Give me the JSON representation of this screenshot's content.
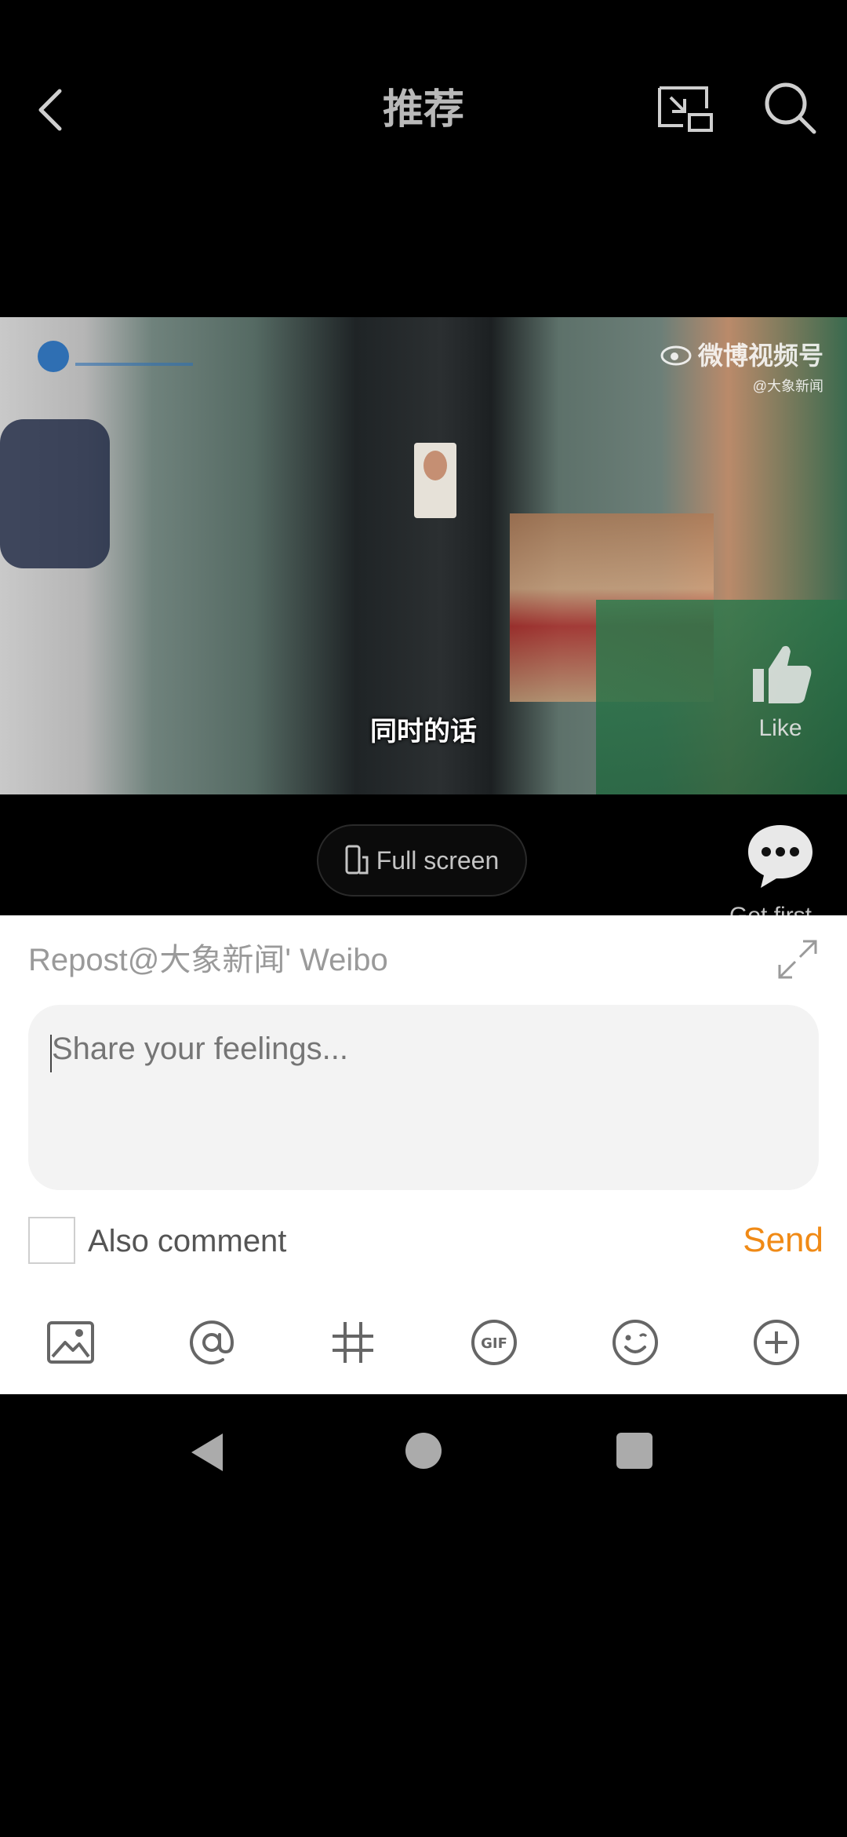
{
  "header": {
    "title": "推荐"
  },
  "video": {
    "subtitle": "同时的话",
    "watermark_brand": "微博视频号",
    "watermark_account": "@大象新闻",
    "like_label": "Like"
  },
  "controls": {
    "fullscreen_label": "Full screen",
    "comment_hint": "Get first"
  },
  "repost": {
    "title": "Repost@大象新闻' Weibo",
    "placeholder": "Share your feelings...",
    "also_comment_label": "Also comment",
    "send_label": "Send"
  },
  "toolbar": {
    "items": [
      "image-icon",
      "mention-icon",
      "hashtag-icon",
      "gif-icon",
      "emoji-icon",
      "add-icon"
    ]
  },
  "colors": {
    "accent": "#f08a16",
    "sheet_bg": "#ffffff",
    "input_bg": "#f3f3f3"
  }
}
